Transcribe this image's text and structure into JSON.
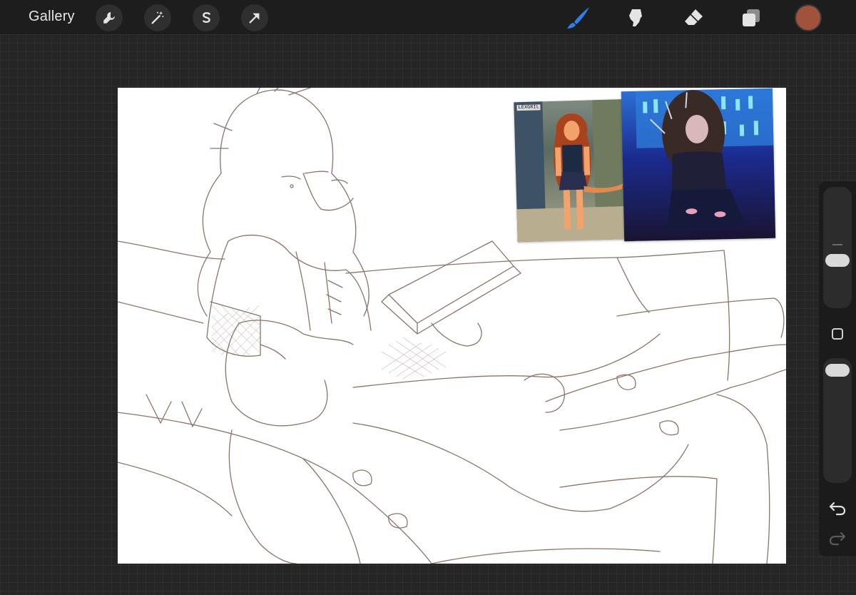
{
  "topbar": {
    "gallery_label": "Gallery",
    "left_tools": [
      "wrench-icon",
      "magic-wand-icon",
      "selection-s-icon",
      "transform-arrow-icon"
    ],
    "right_tools": [
      "brush-icon",
      "smudge-icon",
      "eraser-icon",
      "layers-icon"
    ],
    "active_tool": "brush-icon",
    "colors": {
      "bar": "#1d1d1d",
      "active_tool": "#2f7fe8",
      "icon": "#e4e4e4",
      "current_color": "#a0523a"
    }
  },
  "canvas": {
    "background": "#ffffff",
    "line_color": "#8a746c",
    "reference_images": [
      "orange-haired-character-reference",
      "dark-haired-character-reference"
    ]
  },
  "reference": {
    "watermark": "LEXGRIL"
  },
  "sidebar": {
    "brush_size_level": 0.4,
    "opacity_level": 0.0,
    "icons": [
      "modify-square-icon",
      "undo-icon",
      "redo-icon"
    ]
  }
}
